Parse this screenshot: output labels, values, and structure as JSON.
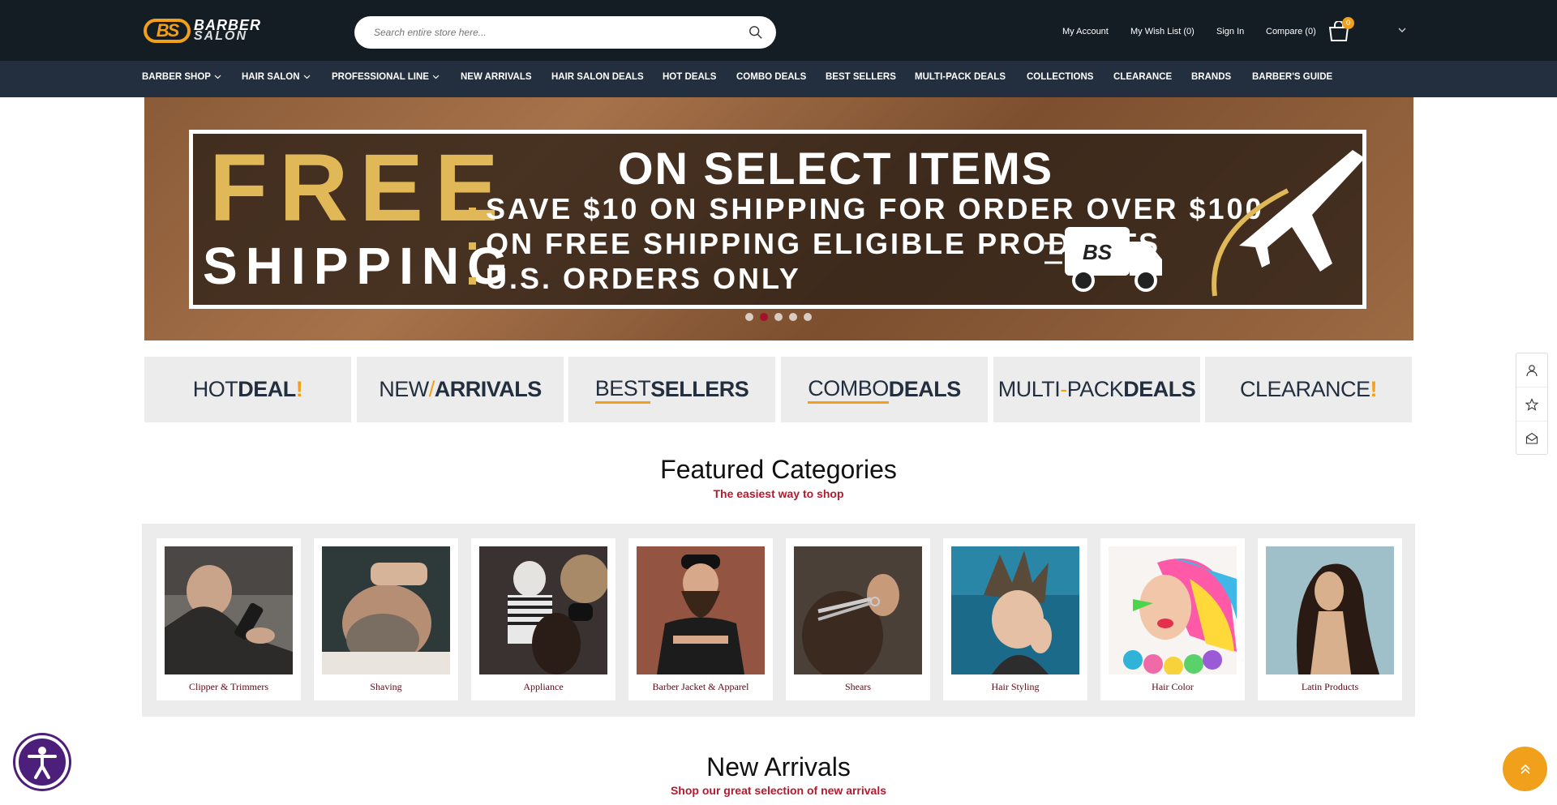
{
  "header": {
    "logo_main": "BARBER",
    "logo_sub": "SALON",
    "logo_mark": "BS",
    "search_placeholder": "Search entire store here...",
    "links": [
      "My Account",
      "My Wish List (0)",
      "Sign In",
      "Compare (0)"
    ],
    "cart_count": "0"
  },
  "nav": [
    {
      "label": "BARBER SHOP",
      "dropdown": true
    },
    {
      "label": "HAIR SALON",
      "dropdown": true
    },
    {
      "label": "PROFESSIONAL LINE",
      "dropdown": true
    },
    {
      "label": "NEW ARRIVALS",
      "dropdown": false
    },
    {
      "label": "HAIR SALON DEALS",
      "dropdown": false
    },
    {
      "label": "HOT DEALS",
      "dropdown": false
    },
    {
      "label": "COMBO DEALS",
      "dropdown": false
    },
    {
      "label": "BEST SELLERS",
      "dropdown": false
    },
    {
      "label": "MULTI-PACK DEALS",
      "dropdown": false
    },
    {
      "label": "COLLECTIONS",
      "dropdown": false
    },
    {
      "label": "CLEARANCE",
      "dropdown": false
    },
    {
      "label": "BRANDS",
      "dropdown": false
    },
    {
      "label": "BARBER'S GUIDE",
      "dropdown": false
    }
  ],
  "banner": {
    "free": "FREE",
    "shipping": "SHIPPING",
    "headline": "ON SELECT ITEMS",
    "lines": [
      "SAVE $10 ON SHIPPING FOR ORDER OVER $100",
      "ON FREE SHIPPING ELIGIBLE PRODUCTS",
      "U.S. ORDERS ONLY"
    ],
    "truck_logo": "BS",
    "slide_count": 5,
    "active_slide": 2
  },
  "tiles": {
    "hot": {
      "a": "HOT ",
      "b": "DEAL",
      "c": "!"
    },
    "new": {
      "a": "NEW",
      "sep": "/",
      "b": "ARRIVALS"
    },
    "best": {
      "a": "BEST ",
      "b": "SELLERS"
    },
    "combo": {
      "a": "COMBO ",
      "b": "DEALS"
    },
    "multi": {
      "a": "MULTI",
      "sep": "-",
      "a2": "PACK ",
      "b": "DEALS"
    },
    "clear": {
      "a": "CLEARANCE",
      "c": "!"
    }
  },
  "featured": {
    "title": "Featured Categories",
    "subtitle": "The easiest way to shop",
    "categories": [
      "Clipper & Trimmers",
      "Shaving",
      "Appliance",
      "Barber Jacket & Apparel",
      "Shears",
      "Hair Styling",
      "Hair Color",
      "Latin Products"
    ]
  },
  "new_arrivals": {
    "title": "New Arrivals",
    "subtitle": "Shop our great selection of new arrivals"
  },
  "colors": {
    "header_bg": "#141c24",
    "nav_bg": "#232f3e",
    "accent": "#f0a01a",
    "brand_red": "#b5192e"
  }
}
